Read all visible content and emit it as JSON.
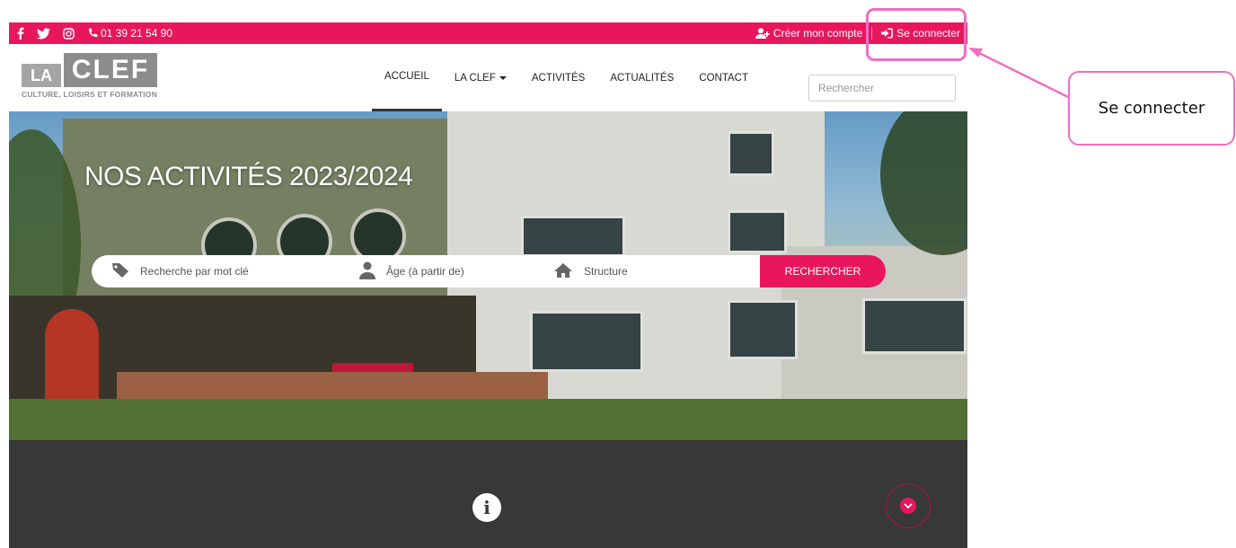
{
  "colors": {
    "accent": "#e8175d",
    "dark_band": "#383838",
    "annotation": "#ee6fc0"
  },
  "topbar": {
    "social_icons": [
      "facebook-icon",
      "twitter-icon",
      "instagram-icon"
    ],
    "phone": "01 39 21 54 90",
    "create_account": "Créer mon compte",
    "login": "Se connecter"
  },
  "header": {
    "logo": {
      "letters_la": "LA",
      "letters_clef": "CLEF",
      "tagline": "CULTURE, LOISIRS ET FORMATION"
    },
    "nav": [
      {
        "label": "ACCUEIL",
        "active": true
      },
      {
        "label": "LA CLEF",
        "dropdown": true
      },
      {
        "label": "ACTIVITÉS"
      },
      {
        "label": "ACTUALITÉS"
      },
      {
        "label": "CONTACT"
      }
    ],
    "search_placeholder": "Rechercher"
  },
  "hero": {
    "title": "NOS ACTIVITÉS 2023/2024",
    "search": {
      "keyword_placeholder": "Recherche par mot clé",
      "age_placeholder": "Âge (à partir de)",
      "structure_placeholder": "Structure",
      "button": "RECHERCHER"
    }
  },
  "band": {
    "info_icon": "info-icon",
    "scroll_icon": "chevron-down-icon"
  },
  "annotation": {
    "label": "Se connecter"
  }
}
